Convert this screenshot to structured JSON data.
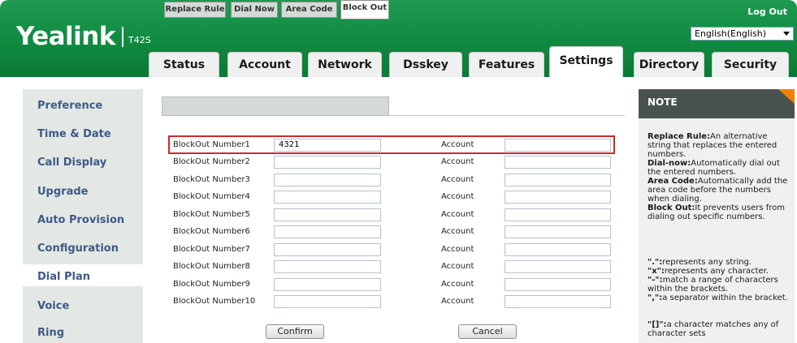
{
  "header": {
    "logo_word": "Yealink",
    "logo_model": "T42S",
    "logout": "Log Out",
    "language": "English(English)"
  },
  "tabs": [
    {
      "label": "Status"
    },
    {
      "label": "Account"
    },
    {
      "label": "Network"
    },
    {
      "label": "Dsskey"
    },
    {
      "label": "Features"
    },
    {
      "label": "Settings",
      "active": true
    },
    {
      "label": "Directory"
    },
    {
      "label": "Security"
    }
  ],
  "sidebar": {
    "items": [
      {
        "label": "Preference"
      },
      {
        "label": "Time & Date"
      },
      {
        "label": "Call Display"
      },
      {
        "label": "Upgrade"
      },
      {
        "label": "Auto Provision"
      },
      {
        "label": "Configuration"
      },
      {
        "label": "Dial Plan",
        "active": true
      },
      {
        "label": "Voice"
      },
      {
        "label": "Ring"
      }
    ]
  },
  "subtabs": [
    {
      "label": "Replace Rule"
    },
    {
      "label": "Dial Now"
    },
    {
      "label": "Area Code"
    },
    {
      "label": "Block Out",
      "active": true
    }
  ],
  "account_label": "Account",
  "rows": [
    {
      "label": "BlockOut Number1",
      "value": "4321",
      "account": ""
    },
    {
      "label": "BlockOut Number2",
      "value": "",
      "account": ""
    },
    {
      "label": "BlockOut Number3",
      "value": "",
      "account": ""
    },
    {
      "label": "BlockOut Number4",
      "value": "",
      "account": ""
    },
    {
      "label": "BlockOut Number5",
      "value": "",
      "account": ""
    },
    {
      "label": "BlockOut Number6",
      "value": "",
      "account": ""
    },
    {
      "label": "BlockOut Number7",
      "value": "",
      "account": ""
    },
    {
      "label": "BlockOut Number8",
      "value": "",
      "account": ""
    },
    {
      "label": "BlockOut Number9",
      "value": "",
      "account": ""
    },
    {
      "label": "BlockOut Number10",
      "value": "",
      "account": ""
    }
  ],
  "buttons": {
    "confirm": "Confirm",
    "cancel": "Cancel"
  },
  "note": {
    "title": "NOTE",
    "replace_term": "Replace Rule:",
    "replace_desc": "An alternative string that replaces the entered numbers.",
    "dialnow_term": "Dial-now:",
    "dialnow_desc": "Automatically dial out the entered numbers.",
    "area_term": "Area Code:",
    "area_desc": "Automatically add the area code before the numbers when dialing.",
    "block_term": "Block Out:",
    "block_desc": "It prevents users from dialing out specific numbers.",
    "sym1_term": "\".\":",
    "sym1_desc": "represents any string.",
    "sym2_term": "\"x\":",
    "sym2_desc": "represents any character.",
    "sym3_term": "\"-\":",
    "sym3_desc": "match a range of characters within the brackets.",
    "sym4_term": "\",\":",
    "sym4_desc": "a separator within the bracket.",
    "sym5_term": "\"[]\":",
    "sym5_desc": "a character matches any of character sets"
  },
  "colors": {
    "header_green": "#108a40",
    "sidebar_bg": "#e3e8e5",
    "sidebar_text": "#3f5a87",
    "note_header": "#48534d",
    "note_accent": "#f08200",
    "highlight_red": "#d0282c"
  }
}
